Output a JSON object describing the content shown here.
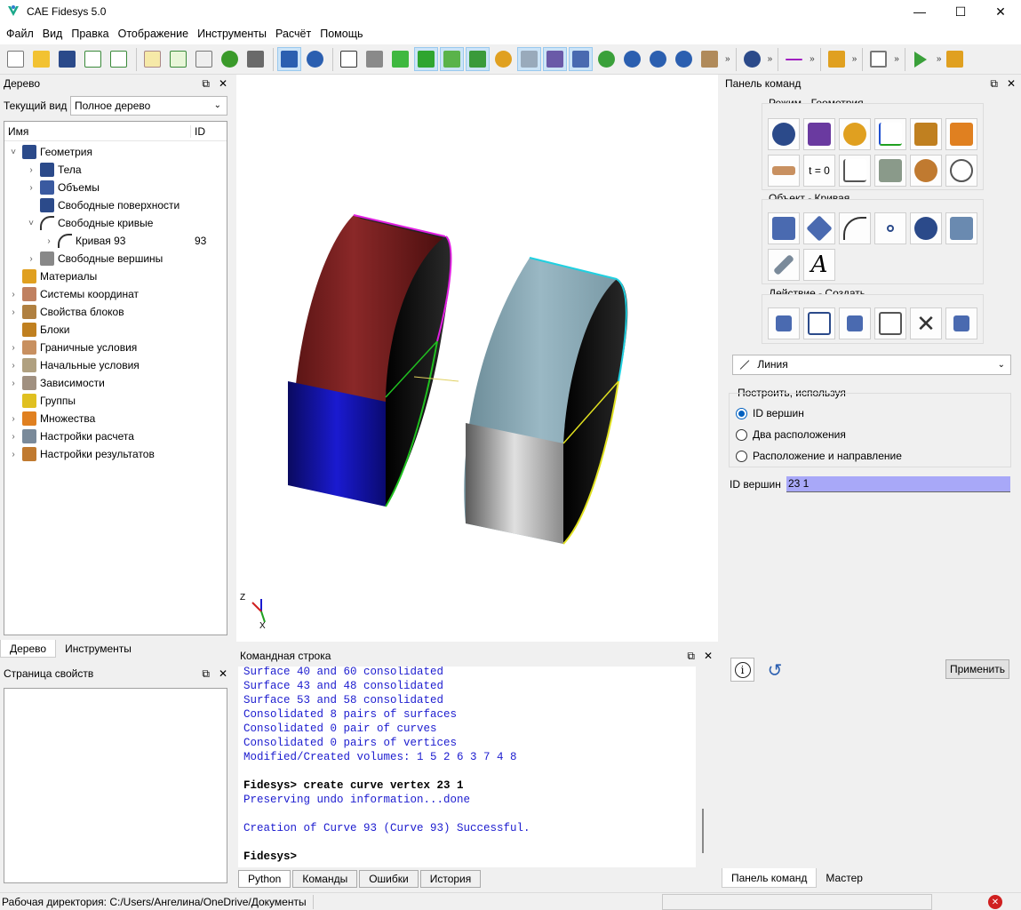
{
  "app": {
    "title": "CAE Fidesys 5.0"
  },
  "menu": [
    "Файл",
    "Вид",
    "Правка",
    "Отображение",
    "Инструменты",
    "Расчёт",
    "Помощь"
  ],
  "tree_panel": {
    "title": "Дерево",
    "current_view_label": "Текущий вид",
    "current_view_value": "Полное дерево",
    "col_name": "Имя",
    "col_id": "ID",
    "items": [
      {
        "label": "Геометрия",
        "id": ""
      },
      {
        "label": "Тела",
        "id": ""
      },
      {
        "label": "Объемы",
        "id": ""
      },
      {
        "label": "Свободные поверхности",
        "id": ""
      },
      {
        "label": "Свободные кривые",
        "id": ""
      },
      {
        "label": "Кривая 93",
        "id": "93"
      },
      {
        "label": "Свободные вершины",
        "id": ""
      },
      {
        "label": "Материалы",
        "id": ""
      },
      {
        "label": "Системы координат",
        "id": ""
      },
      {
        "label": "Свойства блоков",
        "id": ""
      },
      {
        "label": "Блоки",
        "id": ""
      },
      {
        "label": "Граничные условия",
        "id": ""
      },
      {
        "label": "Начальные условия",
        "id": ""
      },
      {
        "label": "Зависимости",
        "id": ""
      },
      {
        "label": "Группы",
        "id": ""
      },
      {
        "label": "Множества",
        "id": ""
      },
      {
        "label": "Настройки расчета",
        "id": ""
      },
      {
        "label": "Настройки результатов",
        "id": ""
      }
    ],
    "tabs": [
      "Дерево",
      "Инструменты"
    ]
  },
  "props_panel": {
    "title": "Страница свойств"
  },
  "cmd_panel": {
    "title": "Командная строка",
    "lines": [
      "Surface 40 and 60 consolidated",
      "Surface 43 and 48 consolidated",
      "Surface 53 and 58 consolidated",
      "Consolidated 8 pairs of surfaces",
      "Consolidated 0 pair of curves",
      "Consolidated 0 pairs of vertices",
      "Modified/Created volumes: 1 5 2 6 3 7 4 8",
      "",
      "Fidesys> create curve vertex 23 1",
      "Preserving undo information...done",
      "",
      "Creation of Curve 93 (Curve 93) Successful.",
      "",
      "Fidesys>"
    ],
    "tabs": [
      "Python",
      "Команды",
      "Ошибки",
      "История"
    ]
  },
  "command_panel": {
    "title": "Панель команд",
    "mode_label": "Режим - Геометрия",
    "object_label": "Объект - Кривая",
    "action_label": "Действие - Создать",
    "t0_label": "t = 0",
    "text_icon": "A",
    "dropdown_value": "Линия",
    "build_label": "Построить, используя",
    "options": [
      "ID вершин",
      "Два расположения",
      "Расположение и направление"
    ],
    "vertex_id_label": "ID вершин",
    "vertex_id_value": "23 1",
    "info_glyph": "i",
    "apply_button": "Применить",
    "tabs": [
      "Панель команд",
      "Мастер"
    ]
  },
  "axes": {
    "z": "Z",
    "x": "X"
  },
  "status": {
    "workdir": "Рабочая директория: C:/Users/Ангелина/OneDrive/Документы"
  },
  "window_controls": {
    "min": "—",
    "max": "☐",
    "close": "✕"
  },
  "panel_controls": {
    "float": "⧉",
    "close": "✕"
  }
}
